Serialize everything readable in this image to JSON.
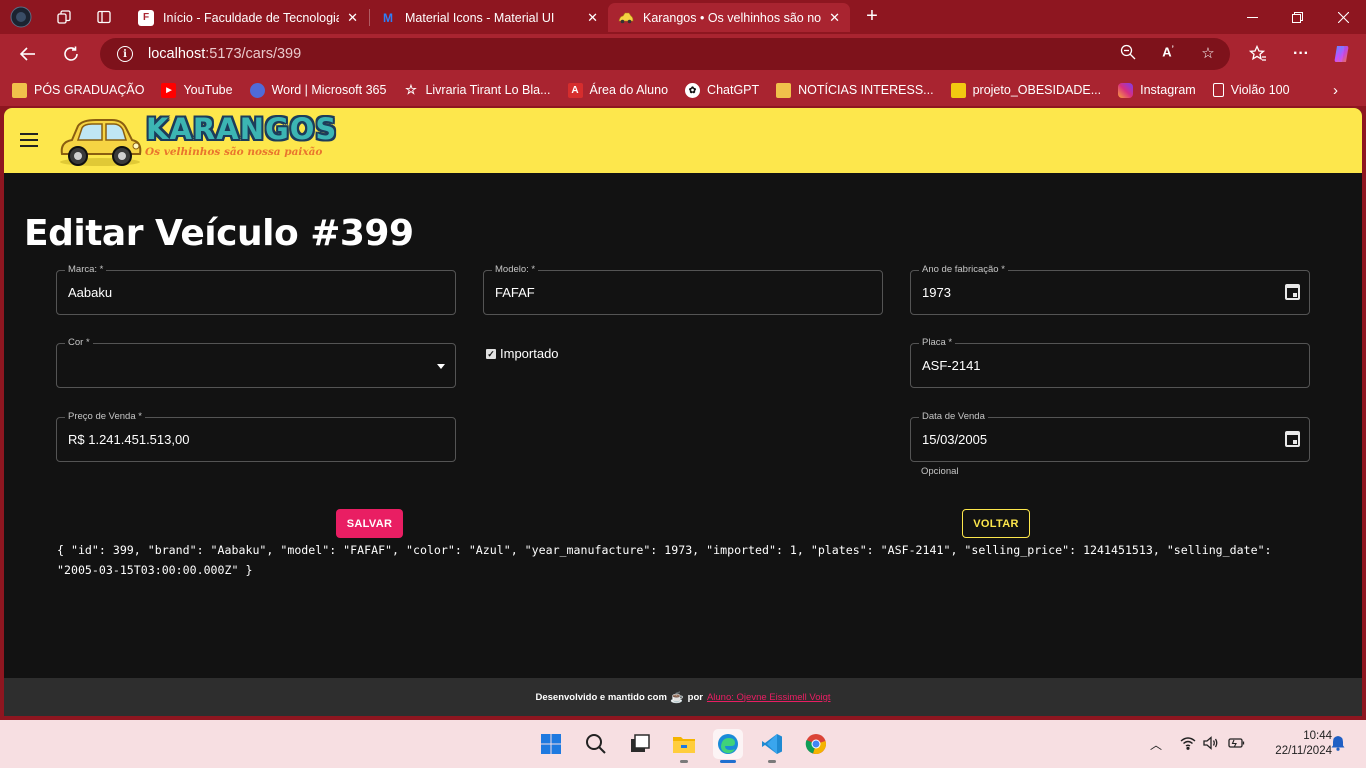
{
  "browser": {
    "tabs": [
      {
        "title": "Início - Faculdade de Tecnologia de",
        "favicon": "fatec-icon"
      },
      {
        "title": "Material Icons - Material UI",
        "favicon": "mui-icon"
      },
      {
        "title": "Karangos • Os velhinhos são nossa paixão",
        "favicon": "karangos-icon",
        "active": true
      }
    ],
    "address": {
      "host": "localhost",
      "path": ":5173/cars/399"
    },
    "bookmarks": [
      {
        "label": "PÓS GRADUAÇÃO",
        "icon": "folder-icon"
      },
      {
        "label": "YouTube",
        "icon": "youtube-icon"
      },
      {
        "label": "Word | Microsoft 365",
        "icon": "word-icon"
      },
      {
        "label": "Livraria Tirant Lo Bla...",
        "icon": "tirant-icon"
      },
      {
        "label": "Área do Aluno",
        "icon": "aluno-icon"
      },
      {
        "label": "ChatGPT",
        "icon": "chatgpt-icon"
      },
      {
        "label": "NOTÍCIAS INTERESS...",
        "icon": "folder-icon"
      },
      {
        "label": "projeto_OBESIDADE...",
        "icon": "powerbi-icon"
      },
      {
        "label": "Instagram",
        "icon": "instagram-icon"
      },
      {
        "label": "Violão 100",
        "icon": "page-icon"
      }
    ]
  },
  "app": {
    "brand": "KARANGOS",
    "tagline": "Os velhinhos são nossa paixão",
    "page_title": "Editar Veículo #399",
    "form": {
      "brand": {
        "label": "Marca: *",
        "value": "Aabaku"
      },
      "model": {
        "label": "Modelo: *",
        "value": "FAFAF"
      },
      "year": {
        "label": "Ano de fabricação *",
        "value": "1973"
      },
      "color": {
        "label": "Cor *",
        "value": ""
      },
      "imported": {
        "label": "Importado",
        "checked": true
      },
      "plates": {
        "label": "Placa *",
        "value": "ASF-2141"
      },
      "price": {
        "label": "Preço de Venda *",
        "value": "R$ 1.241.451.513,00"
      },
      "sale_date": {
        "label": "Data de Venda",
        "value": "15/03/2005",
        "helper": "Opcional"
      }
    },
    "save_label": "SALVAR",
    "back_label": "VOLTAR",
    "json_dump": "{ \"id\": 399, \"brand\": \"Aabaku\", \"model\": \"FAFAF\", \"color\": \"Azul\", \"year_manufacture\": 1973, \"imported\": 1, \"plates\": \"ASF-2141\", \"selling_price\": 1241451513, \"selling_date\": \"2005-03-15T03:00:00.000Z\" }",
    "footer": {
      "text": "Desenvolvido e mantido com",
      "by": "por",
      "link": "Aluno: Ojevne Eissimell Voigt"
    }
  },
  "taskbar": {
    "time": "10:44",
    "date": "22/11/2024"
  },
  "colors": {
    "browser_frame": "#8e1620",
    "appbar": "#fde74c",
    "page_bg": "#121212",
    "primary": "#e91e63",
    "secondary": "#fde74c"
  }
}
